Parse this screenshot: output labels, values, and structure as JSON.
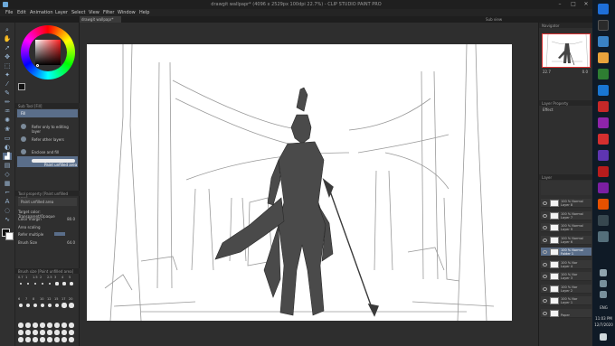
{
  "window": {
    "title": "drawgit wallpapr* (4096 x 2529px 100dpi 22.7%) - CLIP STUDIO PAINT PRO",
    "controls": [
      "–",
      "□",
      "✕"
    ]
  },
  "menu": [
    "File",
    "Edit",
    "Animation",
    "Layer",
    "Select",
    "View",
    "Filter",
    "Window",
    "Help"
  ],
  "document_tab": "drawgit wallpapr*",
  "sub_label": "Sub view",
  "left_panel": {
    "subtool_header": "Sub Tool [Fill]",
    "subtool_search": "Fill",
    "subtools": [
      "Refer only to editing layer",
      "Refer other layers",
      "Enclose and fill",
      "Paint unfilled area"
    ],
    "property_header": "Tool property [Paint unfilled area]",
    "properties": {
      "fill_label": "Paint unfilled area",
      "target_color": "Target color: Transparent/Opaque",
      "color_margin_label": "Color margin",
      "color_margin_value": "80.0",
      "area_scaling": "Area scaling",
      "refer_multiple": "Refer multiple",
      "brush_size_label": "Brush Size",
      "brush_size_value": "64.0"
    },
    "brush_size_header": "Brush size [Paint unfilled area]",
    "brush_sizes": [
      "0.7",
      "1",
      "1.5",
      "2",
      "2.5",
      "3",
      "4",
      "5",
      "6",
      "7",
      "8",
      "10",
      "12",
      "15",
      "17",
      "20"
    ]
  },
  "right_panel": {
    "navigator_header": "Navigator",
    "zoom_value": "22.7",
    "rotation_value": "0.0",
    "layer_property_header": "Layer Property",
    "effect_label": "Effect",
    "layer_header": "Layer",
    "layers": [
      {
        "name1": "100 % Normal",
        "name2": "Layer 8",
        "selected": false
      },
      {
        "name1": "100 % Normal",
        "name2": "Layer 7",
        "selected": false
      },
      {
        "name1": "100 % Normal",
        "name2": "Layer 9",
        "selected": false
      },
      {
        "name1": "100 % Normal",
        "name2": "Layer 6",
        "selected": false
      },
      {
        "name1": "100 % Normal",
        "name2": "Folder 1",
        "selected": true
      },
      {
        "name1": "100 % Nor",
        "name2": "Layer 4",
        "selected": false
      },
      {
        "name1": "100 % Nor",
        "name2": "Layer 3",
        "selected": false
      },
      {
        "name1": "100 % Nor",
        "name2": "Layer 2",
        "selected": false
      },
      {
        "name1": "100 % Nor",
        "name2": "Layer 1",
        "selected": false
      },
      {
        "name1": "",
        "name2": "Paper",
        "selected": false
      }
    ]
  },
  "taskbar": {
    "lang": "ENG",
    "time": "11:03 PM",
    "date": "12/7/2020"
  },
  "colors": {
    "selection_blue": "#5a6e8a",
    "canvas_bg": "#ffffff",
    "figure_gray": "#4a4a4a",
    "taskbar_bg": "#0f1a26"
  }
}
